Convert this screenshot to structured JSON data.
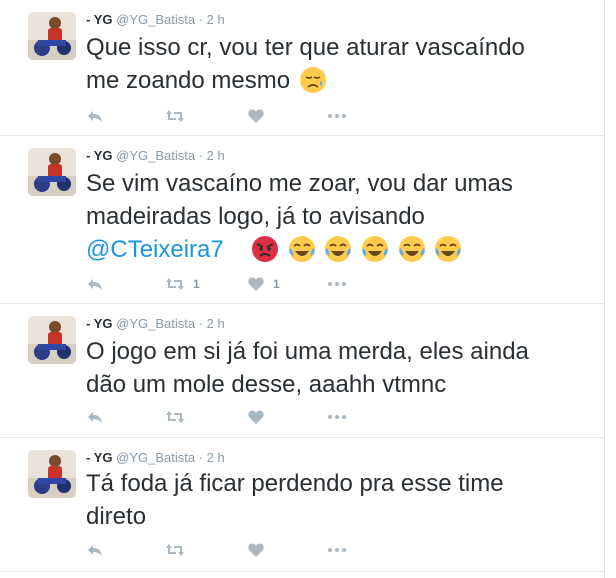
{
  "tweets": [
    {
      "name": "- YG",
      "handle": "@YG_Batista",
      "separator": "·",
      "time": "2 h",
      "text_line1": "Que isso cr, vou ter que aturar vascaíndo",
      "text_line2": "me zoando mesmo",
      "emojis": [
        "disappointed-relieved-emoji"
      ],
      "retweet_count": "",
      "like_count": ""
    },
    {
      "name": "- YG",
      "handle": "@YG_Batista",
      "separator": "·",
      "time": "2 h",
      "text_line1": "Se vim vascaíno me zoar, vou dar umas",
      "text_line2": "madeiradas logo, já to avisando",
      "mention": "@CTeixeira7",
      "emojis": [
        "pouting-face-emoji",
        "joy-emoji",
        "joy-emoji",
        "joy-emoji",
        "joy-emoji",
        "joy-emoji"
      ],
      "retweet_count": "1",
      "like_count": "1"
    },
    {
      "name": "- YG",
      "handle": "@YG_Batista",
      "separator": "·",
      "time": "2 h",
      "text_line1": "O jogo em si já foi uma merda, eles ainda",
      "text_line2": "dão um mole desse, aaahh vtmnc",
      "retweet_count": "",
      "like_count": ""
    },
    {
      "name": "- YG",
      "handle": "@YG_Batista",
      "separator": "·",
      "time": "2 h",
      "text_line1": "Tá foda já ficar perdendo pra esse time",
      "text_line2": "direto",
      "retweet_count": "",
      "like_count": ""
    }
  ],
  "icons": {
    "reply": "reply-icon",
    "retweet": "retweet-icon",
    "like": "heart-icon",
    "more": "more-icon"
  },
  "colors": {
    "text": "#292f33",
    "secondary": "#8899a6",
    "mention": "#1b95e0",
    "action_icon": "#aab8c2",
    "divider": "#e1e8ed"
  }
}
